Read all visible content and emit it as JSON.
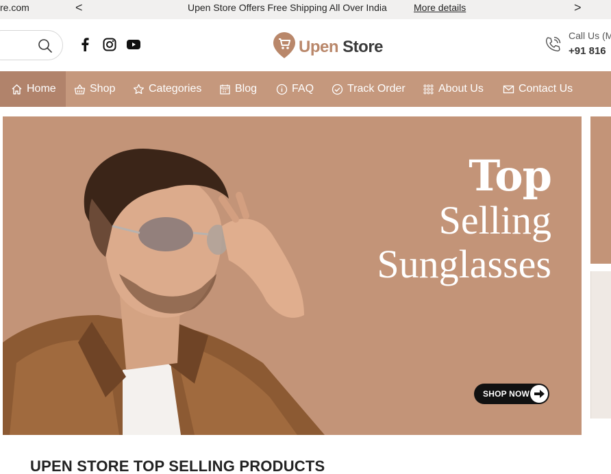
{
  "announcement": {
    "email_fragment": "re.com",
    "message": "Upen Store Offers Free Shipping All Over India",
    "link": "More details",
    "prev_glyph": "<",
    "next_glyph": ">"
  },
  "header": {
    "social": [
      "facebook-icon",
      "instagram-icon",
      "youtube-icon"
    ],
    "logo": {
      "word1": "Upen",
      "word2": "Store"
    },
    "call_label": "Call Us (M",
    "call_number": "+91 816"
  },
  "nav": {
    "items": [
      {
        "label": "Home",
        "icon": "home-icon",
        "active": true
      },
      {
        "label": "Shop",
        "icon": "basket-icon"
      },
      {
        "label": "Categories",
        "icon": "star-icon"
      },
      {
        "label": "Blog",
        "icon": "calendar-icon"
      },
      {
        "label": "FAQ",
        "icon": "info-icon"
      },
      {
        "label": "Track Order",
        "icon": "check-circle-icon"
      },
      {
        "label": "About Us",
        "icon": "grid-icon"
      },
      {
        "label": "Contact Us",
        "icon": "mail-icon"
      }
    ]
  },
  "hero": {
    "line1": "Top",
    "line2": "Selling",
    "line3": "Sunglasses",
    "cta": "SHOP NOW"
  },
  "section": {
    "title": "UPEN STORE TOP SELLING PRODUCTS"
  },
  "colors": {
    "nav_bg": "#c5987d",
    "hero_bg": "#c39478",
    "brand": "#b9876a"
  }
}
